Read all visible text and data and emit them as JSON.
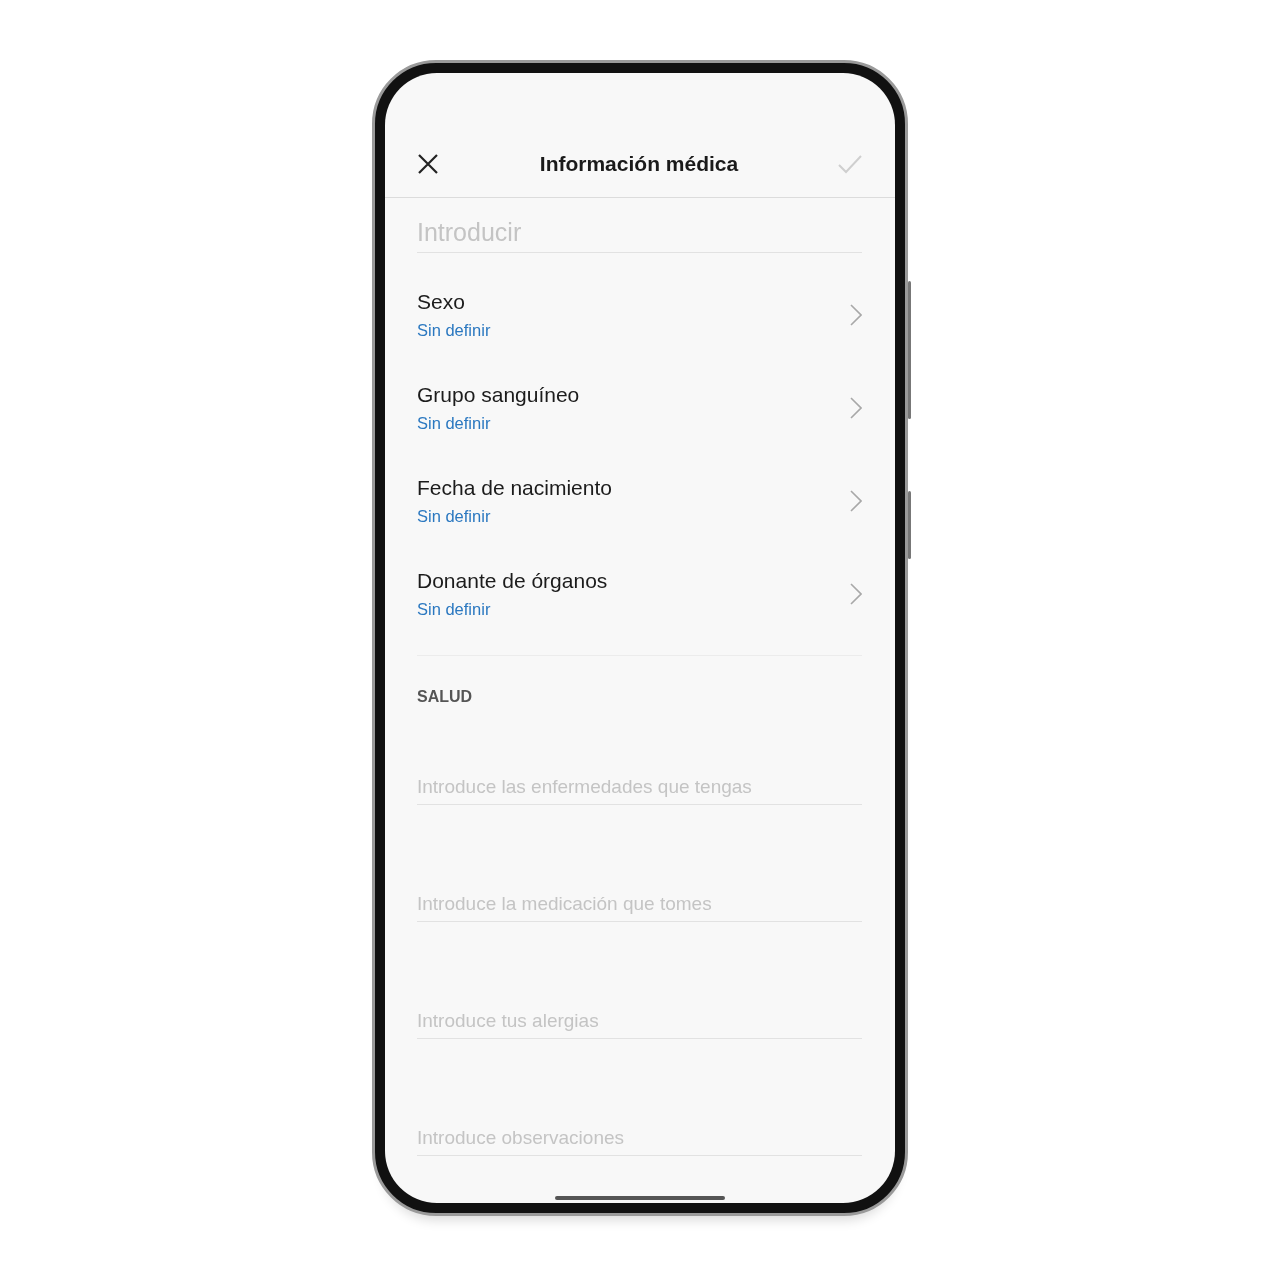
{
  "header": {
    "title": "Información médica",
    "confirm": {
      "disabled": true
    }
  },
  "weight_field": {
    "placeholder": "Introducir"
  },
  "rows": [
    {
      "label": "Sexo",
      "value": "Sin definir"
    },
    {
      "label": "Grupo sanguíneo",
      "value": "Sin definir"
    },
    {
      "label": "Fecha de nacimiento",
      "value": "Sin definir"
    },
    {
      "label": "Donante de órganos",
      "value": "Sin definir"
    }
  ],
  "health": {
    "heading": "SALUD",
    "fields": [
      {
        "placeholder": "Introduce las enfermedades que tengas"
      },
      {
        "placeholder": "Introduce la medicación que tomes"
      },
      {
        "placeholder": "Introduce tus alergias"
      },
      {
        "placeholder": "Introduce observaciones"
      }
    ]
  }
}
